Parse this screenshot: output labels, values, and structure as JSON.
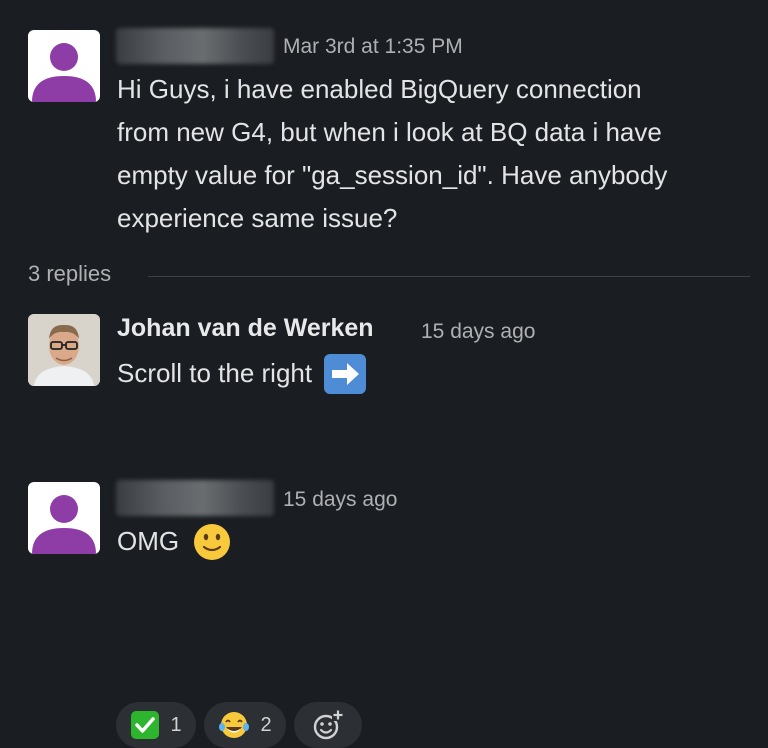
{
  "messages": [
    {
      "timestamp": "Mar 3rd at 1:35 PM",
      "lines": [
        "Hi Guys, i have enabled BigQuery connection",
        "from new G4, but when i look at BQ data i have",
        "empty value for \"ga_session_id\". Have anybody",
        "experience same issue?"
      ]
    }
  ],
  "thread": {
    "replies_label": "3 replies"
  },
  "replies": [
    {
      "sender": "Johan van de Werken",
      "timestamp": "15 days ago",
      "text": "Scroll to the right",
      "emoji": "right-arrow-emoji",
      "reactions": [
        {
          "emoji": "check-mark-emoji",
          "count": "1"
        },
        {
          "emoji": "tears-of-joy-emoji",
          "count": "2"
        }
      ]
    },
    {
      "timestamp": "15 days ago",
      "text": "OMG",
      "emoji": "slightly-smiling-face-emoji"
    }
  ],
  "colors": {
    "background": "#1a1d21",
    "avatar_purple": "#8e3ca6",
    "check_green": "#2eb52e",
    "arrow_blue": "#4f8cd6"
  }
}
